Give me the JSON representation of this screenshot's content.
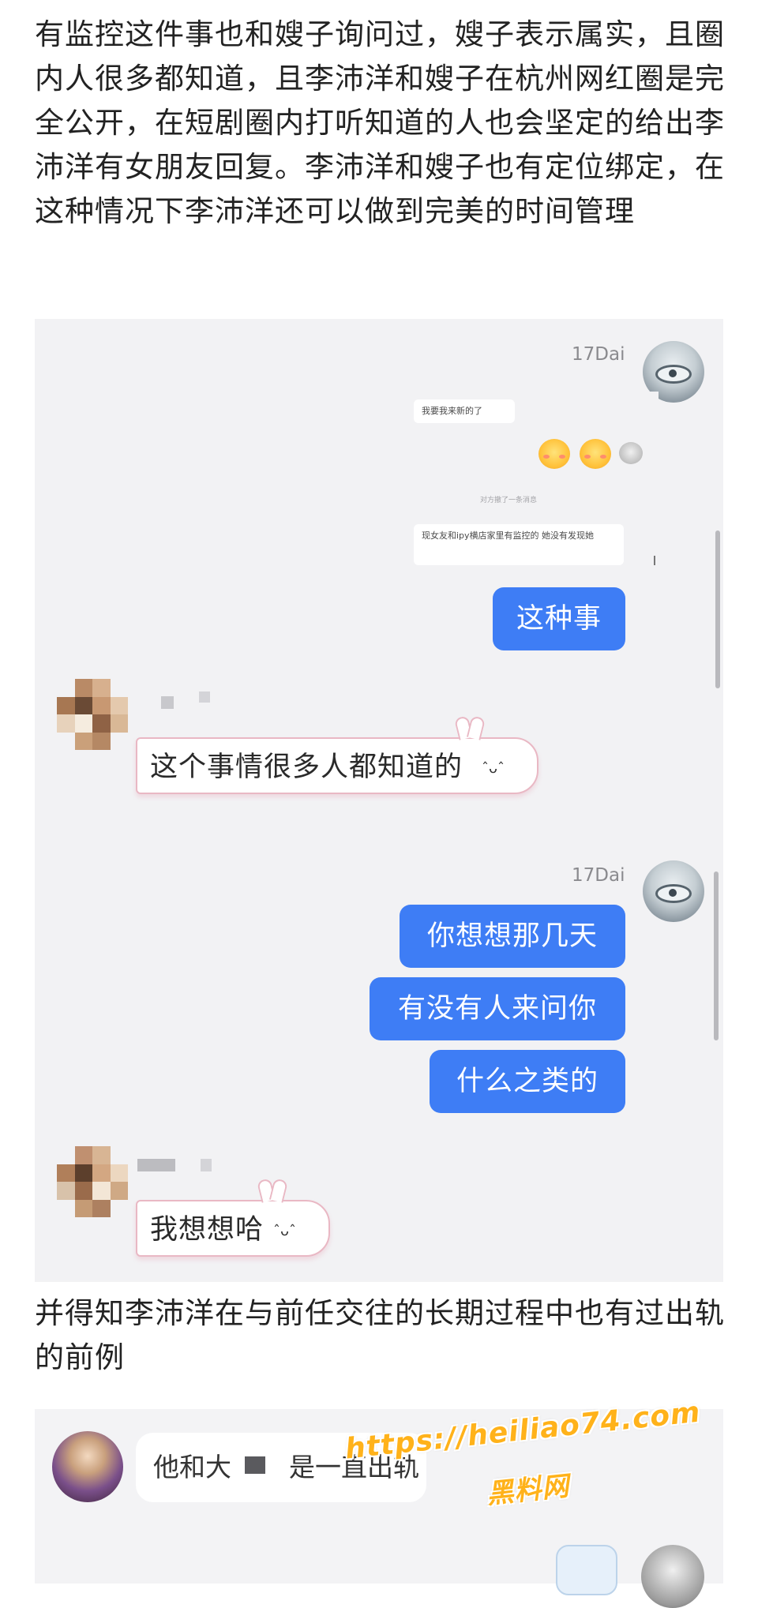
{
  "article": {
    "paragraph_1": "有监控这件事也和嫂子询问过，嫂子表示属实，且圈内人很多都知道，且李沛洋和嫂子在杭州网红圈是完全公开，在短剧圈内打听知道的人也会坚定的给出李沛洋有女朋友回复。李沛洋和嫂子也有定位绑定，在这种情况下李沛洋还可以做到完美的时间管理",
    "paragraph_2": "并得知李沛洋在与前任交往的长期过程中也有过出轨的前例"
  },
  "screenshot_1": {
    "sender_name_1": "17Dai",
    "quoted": {
      "line_1": "我要我来新的了",
      "system": "对方撤了一条消息",
      "line_3": "现女友和ipy横店家里有监控的 她没有发现她"
    },
    "msg_1": "这种事",
    "reply_1": "这个事情很多人都知道的",
    "reply_face": "ˆᴗˆ",
    "sender_name_2": "17Dai",
    "msg_2": "你想想那几天",
    "msg_3": "有没有人来问你",
    "msg_4": "什么之类的",
    "reply_2": "我想想哈"
  },
  "screenshot_2": {
    "message_start": "他和大",
    "message_end": "是一直出轨"
  },
  "watermark": {
    "url": "https://heiliao74.com",
    "name": "黑料网"
  },
  "colors": {
    "sent_bubble": "#3e7df5",
    "chat_background": "#f2f2f4",
    "bubble_outline_pink": "#e9b8c4",
    "watermark": "#ffb21a"
  },
  "icons": [
    "profile-avatar",
    "bunny-ears-decoration",
    "emoji-face"
  ]
}
